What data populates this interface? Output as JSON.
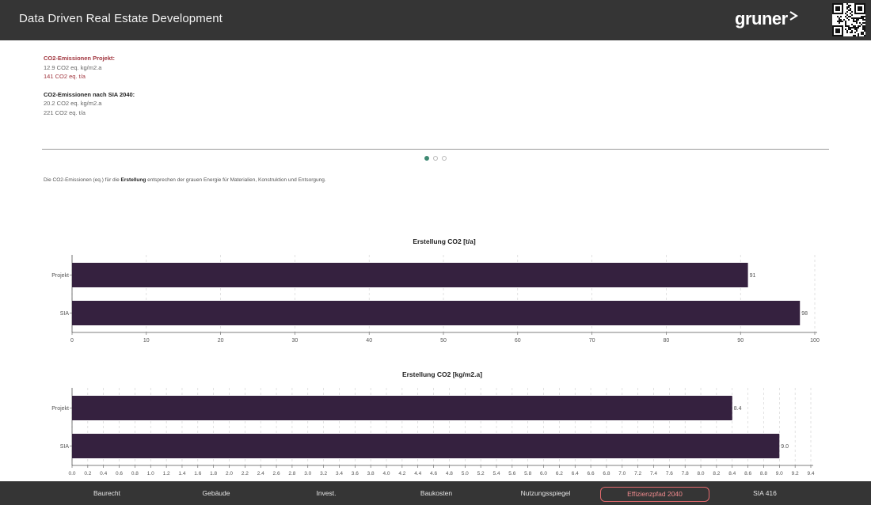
{
  "header": {
    "title": "Data Driven Real Estate Development",
    "brand": "gruner"
  },
  "info": {
    "project_heading": "CO2-Emissionen Projekt:",
    "project_line1": "12.9 CO2 eq. kg/m2.a",
    "project_line2": "141 CO2 eq. t/a",
    "sia_heading": "CO2-Emissionen nach SIA 2040:",
    "sia_line1": "20.2 CO2 eq. kg/m2.a",
    "sia_line2": "221 CO2 eq. t/a"
  },
  "carousel": {
    "pages": 3,
    "active": 0
  },
  "note": {
    "prefix": "Die CO2-Emissionen (eq.) für die ",
    "bold": "Erstellung",
    "suffix": " entsprechen der grauen Energie für Materialien, Konstruktion und Entsorgung."
  },
  "chart_data": [
    {
      "type": "bar",
      "orientation": "horizontal",
      "title": "Erstellung CO2 [t/a]",
      "categories": [
        "Projekt",
        "SIA"
      ],
      "values": [
        91,
        98
      ],
      "data_labels": [
        "91",
        "98"
      ],
      "xlim": [
        0,
        100
      ],
      "xticks": [
        0,
        10,
        20,
        30,
        40,
        50,
        60,
        70,
        80,
        90,
        100
      ],
      "xtick_labels": [
        "0",
        "10",
        "20",
        "30",
        "40",
        "50",
        "60",
        "70",
        "80",
        "90",
        "100"
      ],
      "grid": true,
      "color": "#35213f"
    },
    {
      "type": "bar",
      "orientation": "horizontal",
      "title": "Erstellung CO2 [kg/m2.a]",
      "categories": [
        "Projekt",
        "SIA"
      ],
      "values": [
        8.4,
        9.0
      ],
      "data_labels": [
        "8.4",
        "9.0"
      ],
      "xlim": [
        0,
        9.4
      ],
      "xticks": [
        0,
        0.2,
        0.4,
        0.6,
        0.8,
        1,
        1.2,
        1.4,
        1.6,
        1.8,
        2,
        2.2,
        2.4,
        2.6,
        2.8,
        3,
        3.2,
        3.4,
        3.6,
        3.8,
        4,
        4.2,
        4.4,
        4.6,
        4.8,
        5,
        5.2,
        5.4,
        5.6,
        5.8,
        6,
        6.2,
        6.4,
        6.6,
        6.8,
        7,
        7.2,
        7.4,
        7.6,
        7.8,
        8,
        8.2,
        8.4,
        8.6,
        8.8,
        9,
        9.2,
        9.4
      ],
      "xtick_labels": [
        "0.0",
        "0.2",
        "0.4",
        "0.6",
        "0.8",
        "1.0",
        "1.2",
        "1.4",
        "1.6",
        "1.8",
        "2.0",
        "2.2",
        "2.4",
        "2.6",
        "2.8",
        "3.0",
        "3.2",
        "3.4",
        "3.6",
        "3.8",
        "4.0",
        "4.2",
        "4.4",
        "4.6",
        "4.8",
        "5.0",
        "5.2",
        "5.4",
        "5.6",
        "5.8",
        "6.0",
        "6.2",
        "6.4",
        "6.6",
        "6.8",
        "7.0",
        "7.2",
        "7.4",
        "7.6",
        "7.8",
        "8.0",
        "8.2",
        "8.4",
        "8.6",
        "8.8",
        "9.0",
        "9.2",
        "9.4"
      ],
      "grid": true,
      "color": "#35213f"
    }
  ],
  "nav": {
    "items": [
      "Baurecht",
      "Gebäude",
      "Invest.",
      "Baukosten",
      "Nutzungsspiegel",
      "Effizienzpfad 2040",
      "SIA 416"
    ],
    "active_index": 5
  },
  "icons": {
    "qr": "qr-code-icon",
    "brand_mark": "chevron-right-icon"
  }
}
